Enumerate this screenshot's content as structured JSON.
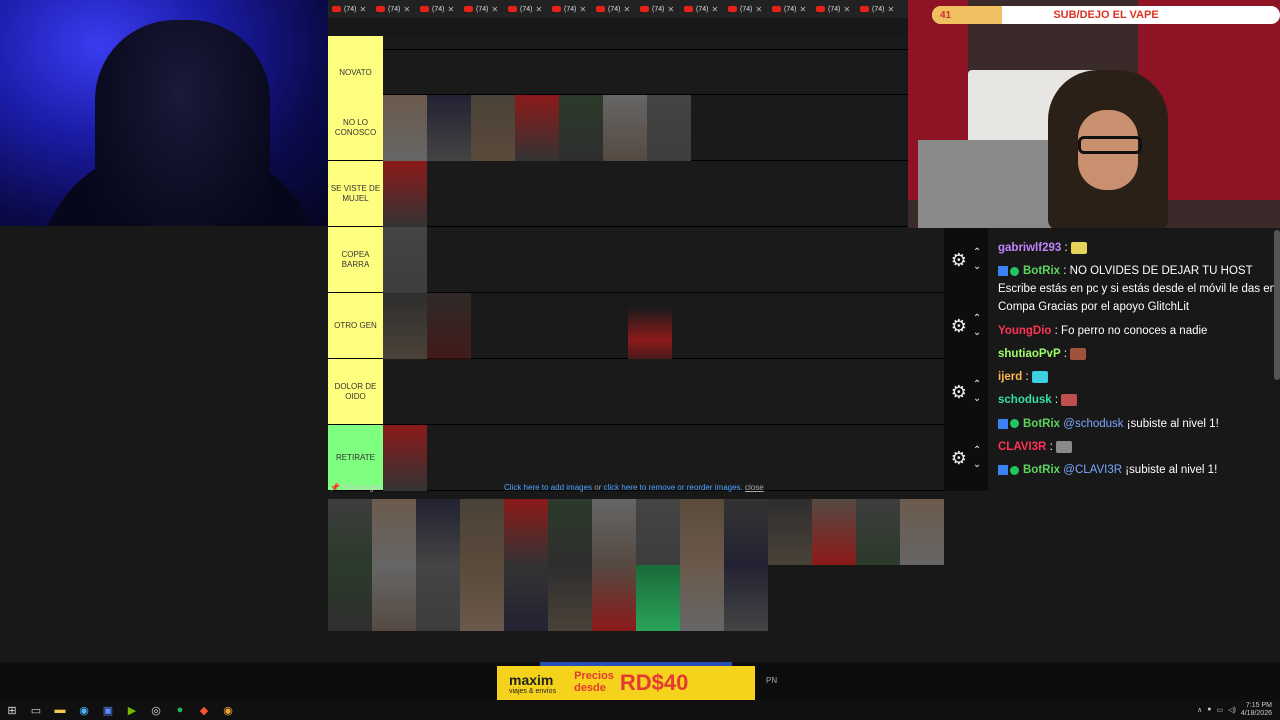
{
  "tabs": {
    "label": "(74)",
    "count": 13
  },
  "tiers": [
    {
      "id": "novato",
      "label": "NOVATO",
      "color": "#ffff7f"
    },
    {
      "id": "no-lo-conosco",
      "label": "NO LO CONOSCO",
      "color": "#ffff7f"
    },
    {
      "id": "se-viste",
      "label": "SE VISTE DE MUJEL",
      "color": "#ffff7f"
    },
    {
      "id": "copea",
      "label": "COPEA BARRA",
      "color": "#ffff7f"
    },
    {
      "id": "otro-gen",
      "label": "OTRO GEN",
      "color": "#ffff7f"
    },
    {
      "id": "dolor",
      "label": "DOLOR DE OIDO",
      "color": "#ffff7f"
    },
    {
      "id": "retirate",
      "label": "RETIRATE",
      "color": "#7fff7f"
    }
  ],
  "pinbar": {
    "pin_label": "Pin Images",
    "add_link": "Click here to add images",
    "or_text": " or ",
    "reorder_link": "click here to remove or reorder images.",
    "close": "close"
  },
  "goal": {
    "count": "41",
    "text": "SUB/DEJO EL VAPE",
    "progress": 0.2
  },
  "chat": [
    {
      "user": "gabriwlf293",
      "color": "#c084fc",
      "text": ":"
    },
    {
      "user": "BotRix",
      "color": "#5cd65c",
      "bot": true,
      "text": ": NO OLVIDES DE DEJAR TU HOST Escribe estás en pc y si estás desde el móvil le das en Compa Gracias por el apoyo GlitchLit"
    },
    {
      "user": "YoungDio",
      "color": "#ff3355",
      "text": ": Fo perro no conoces a nadie"
    },
    {
      "user": "shutiaoPvP",
      "color": "#9dff6a",
      "text": ":"
    },
    {
      "user": "ijerd",
      "color": "#ffb84d",
      "text": ":"
    },
    {
      "user": "schodusk",
      "color": "#34e0a1",
      "text": ":"
    },
    {
      "user": "BotRix",
      "color": "#5cd65c",
      "bot": true,
      "mention": "@schodusk",
      "text": " ¡subiste al nivel 1!"
    },
    {
      "user": "CLAVI3R",
      "color": "#ff3355",
      "text": ":"
    },
    {
      "user": "BotRix",
      "color": "#5cd65c",
      "bot": true,
      "mention": "@CLAVI3R",
      "text": " ¡subiste al nivel 1!"
    }
  ],
  "ad": {
    "brand": "maxim",
    "tagline": "viajes & envíos",
    "promo_line1": "Precios",
    "promo_line2": "desde",
    "price": "RD$40"
  },
  "ad_pn": "PN",
  "clock": {
    "time": "7:15 PM",
    "date": "4/18/2026"
  }
}
